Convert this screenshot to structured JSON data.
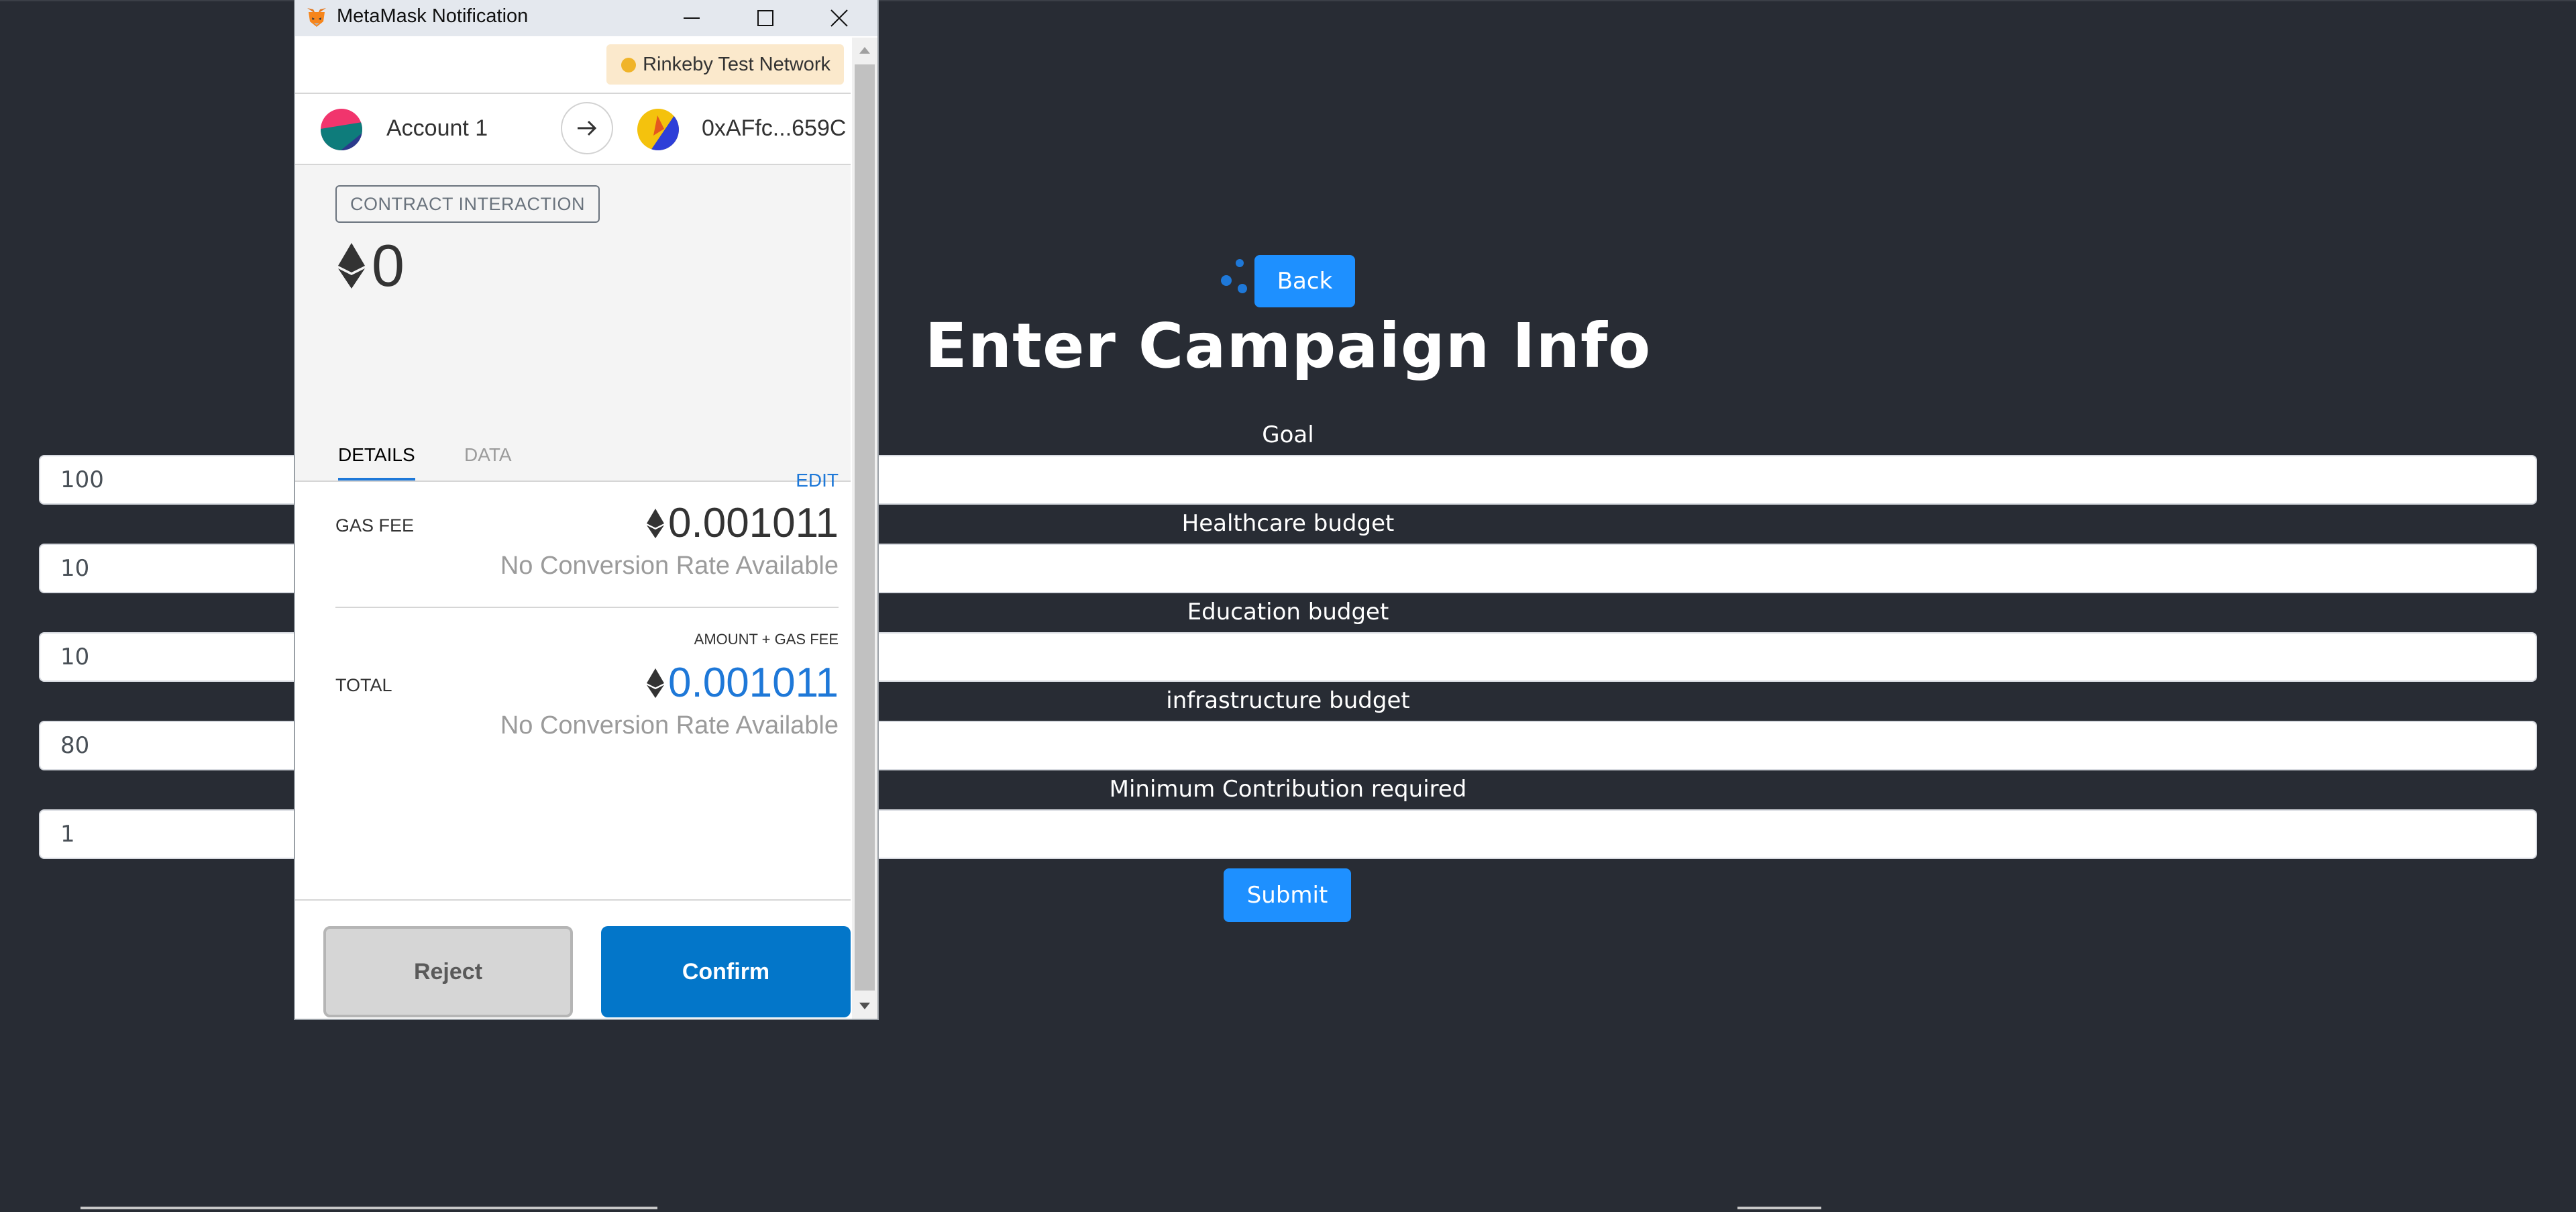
{
  "background": {
    "back_label": "Back",
    "title": "Enter Campaign Info",
    "fields": [
      {
        "label": "Goal",
        "value": "100"
      },
      {
        "label": "Healthcare budget",
        "value": "10"
      },
      {
        "label": "Education budget",
        "value": "10"
      },
      {
        "label": "infrastructure budget",
        "value": "80"
      },
      {
        "label": "Minimum Contribution required",
        "value": "1"
      }
    ],
    "submit_label": "Submit",
    "colors": {
      "page_bg": "#282c34",
      "accent": "#1e90ff"
    }
  },
  "metamask": {
    "window_title": "MetaMask Notification",
    "network": "Rinkeby Test Network",
    "account_name": "Account 1",
    "recipient": "0xAFfc...659C",
    "badge": "CONTRACT INTERACTION",
    "amount": "0",
    "tabs": [
      "DETAILS",
      "DATA"
    ],
    "edit_label": "EDIT",
    "gas_fee_label": "GAS FEE",
    "gas_fee_value": "0.001011",
    "gas_fee_sub": "No Conversion Rate Available",
    "total_caption": "AMOUNT + GAS FEE",
    "total_label": "TOTAL",
    "total_value": "0.001011",
    "total_sub": "No Conversion Rate Available",
    "reject_label": "Reject",
    "confirm_label": "Confirm",
    "icons": [
      "metamask-fox-icon",
      "minimize-icon",
      "maximize-icon",
      "close-icon",
      "arrow-right-icon",
      "eth-icon",
      "scroll-up-icon",
      "scroll-down-icon"
    ],
    "colors": {
      "confirm": "#0376c9",
      "total_value": "#1e78d8",
      "network_dot": "#f0b429"
    }
  }
}
